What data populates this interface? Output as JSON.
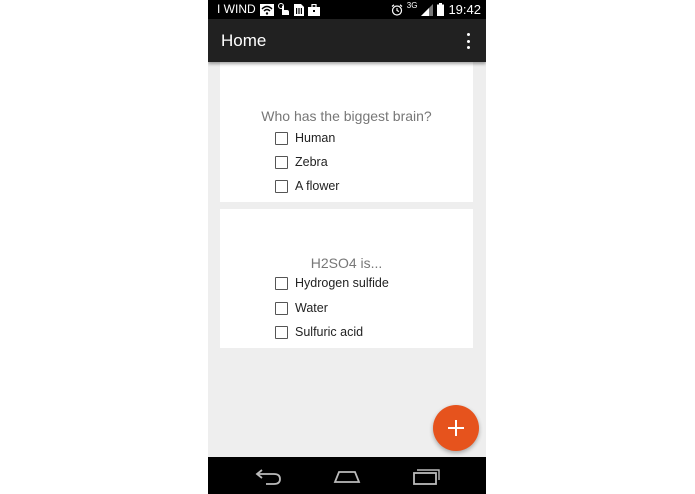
{
  "status_bar": {
    "carrier": "I WIND",
    "network": "3G",
    "time": "19:42",
    "icons": [
      "wifi-icon",
      "tap-icon",
      "sim-card-icon",
      "briefcase-icon",
      "alarm-icon",
      "signal-icon",
      "battery-icon"
    ]
  },
  "app_bar": {
    "title": "Home",
    "menu_icon": "overflow-menu-icon"
  },
  "questions": [
    {
      "text": "Who has the biggest brain?",
      "options": [
        "Human",
        "Zebra",
        "A flower"
      ]
    },
    {
      "text": "H2SO4 is...",
      "options": [
        "Hydrogen sulfide",
        "Water",
        "Sulfuric acid"
      ]
    }
  ],
  "fab": {
    "icon": "plus-icon",
    "color": "#e6531d"
  },
  "nav_bar": {
    "icons": [
      "back-icon",
      "home-icon",
      "recents-icon"
    ]
  },
  "colors": {
    "app_bar": "#212121",
    "background": "#eeeeee",
    "accent": "#e6531d"
  }
}
